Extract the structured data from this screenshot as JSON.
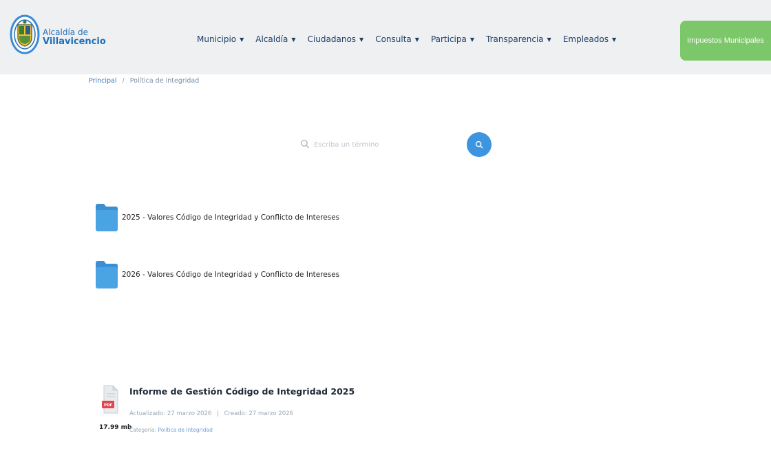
{
  "header": {
    "logo_line1": "Alcaldía de",
    "logo_line2": "Villavicencio",
    "nav": [
      {
        "label": "Municipio"
      },
      {
        "label": "Alcaldía"
      },
      {
        "label": "Ciudadanos"
      },
      {
        "label": "Consulta"
      },
      {
        "label": "Participa"
      },
      {
        "label": "Transparencia"
      },
      {
        "label": "Empleados"
      }
    ],
    "tax_button_label": "Impuestos Municipales"
  },
  "breadcrumb": {
    "home": "Principal",
    "separator": "/",
    "current": "Política de integridad"
  },
  "search": {
    "placeholder": "Escriba un término"
  },
  "folders": [
    {
      "label": "2025 - Valores Código de Integridad y Conflicto de Intereses"
    },
    {
      "label": "2026 - Valores Código de Integridad y Conflicto de Intereses"
    }
  ],
  "document": {
    "title": "Informe de Gestión Código de Integridad 2025",
    "updated": "Actualizado: 27 marzo 2026",
    "separator": "|",
    "created": "Creado: 27 marzo 2026",
    "category_label": "Categoría:",
    "category_value": "Política de Integridad",
    "size": "17.99 mb",
    "file_type": "PDF"
  },
  "colors": {
    "accent_blue": "#3d95e0",
    "folder_blue": "#4aa3e3",
    "tax_green": "#7cc76a",
    "pdf_red": "#e0474c"
  }
}
